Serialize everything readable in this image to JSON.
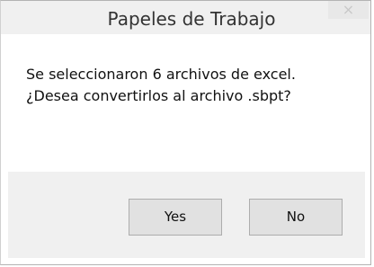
{
  "window": {
    "title": "Papeles de Trabajo",
    "close_glyph": "×"
  },
  "message": {
    "line1": "Se seleccionaron 6 archivos de excel.",
    "line2": "¿Desea convertirlos al archivo .sbpt?"
  },
  "buttons": {
    "yes_label": "Yes",
    "no_label": "No"
  },
  "colors": {
    "titlebar_bg": "#f0f0f0",
    "footer_bg": "#f0f0f0",
    "button_bg": "#e1e1e1"
  }
}
